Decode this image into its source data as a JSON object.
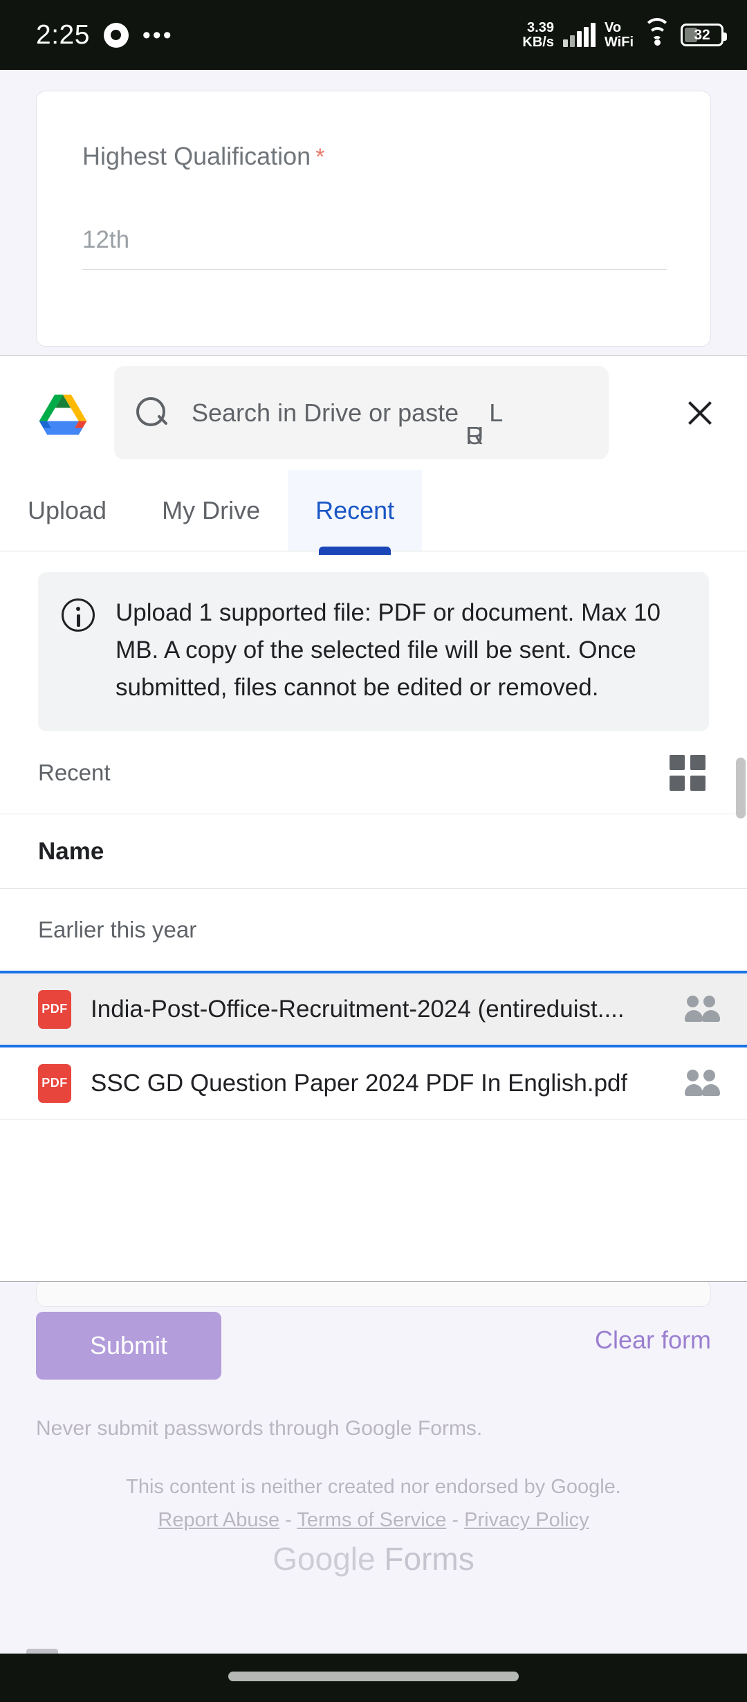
{
  "status_bar": {
    "time": "2:25",
    "browser_icon": "chrome-icon",
    "overflow_dots": "•••",
    "net_speed_value": "3.39",
    "net_speed_unit": "KB/s",
    "volte_line1": "Vo",
    "volte_line2": "WiFi",
    "battery_level": "32"
  },
  "form": {
    "question_title": "Highest Qualification",
    "required_mark": "*",
    "answer_value": "12th",
    "submit_label": "Submit",
    "clear_label": "Clear form",
    "password_note": "Never submit passwords through Google Forms.",
    "disclaimer": "This content is neither created nor endorsed by Google.",
    "link_report_abuse": "Report Abuse",
    "link_terms": "Terms of Service",
    "link_privacy": "Privacy Policy",
    "separator": " - ",
    "logo_google": "Google",
    "logo_forms": " Forms",
    "feedback_icon": "feedback-bubble-icon"
  },
  "picker": {
    "logo": "google-drive-logo",
    "search_placeholder_pre": "Search in Drive or paste ",
    "search_placeholder_glyph_a": "U",
    "search_placeholder_glyph_b": "R",
    "search_placeholder_post": "L",
    "close_icon": "close-icon",
    "tabs": [
      {
        "label": "Upload",
        "active": false
      },
      {
        "label": "My Drive",
        "active": false
      },
      {
        "label": "Recent",
        "active": true
      }
    ],
    "info_notice": "Upload 1 supported file: PDF or document. Max 10 MB. A copy of the selected file will be sent. Once submitted, files cannot be edited or removed.",
    "breadcrumb": "Recent",
    "view_toggle_icon": "grid-view-icon",
    "column_header_name": "Name",
    "group_label": "Earlier this year",
    "files": [
      {
        "name": "India-Post-Office-Recruitment-2024 (entireduist....",
        "type_badge": "PDF",
        "shared": true,
        "selected": true
      },
      {
        "name": "SSC GD Question Paper 2024 PDF In English.pdf",
        "type_badge": "PDF",
        "shared": true,
        "selected": false
      }
    ]
  },
  "colors": {
    "accent_blue": "#1a73e8",
    "tab_active_blue": "#1a46b8",
    "submit_purple": "#b39ddb",
    "pdf_red": "#e8453c",
    "form_bg": "#f6f4fb"
  }
}
